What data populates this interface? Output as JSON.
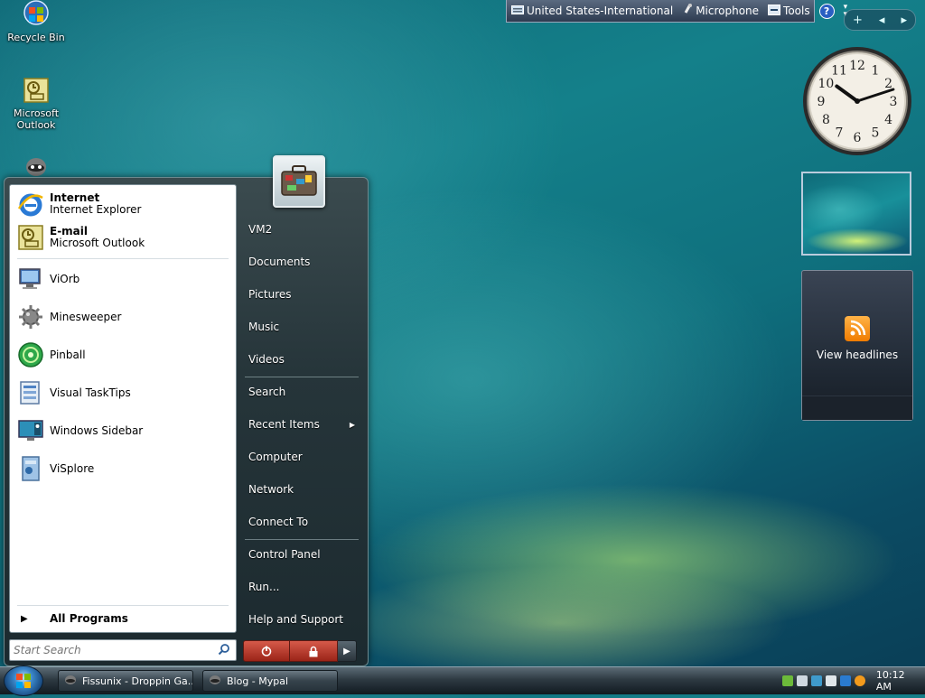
{
  "desktop": {
    "icons": [
      {
        "label": "Recycle Bin"
      },
      {
        "label": "Microsoft Outlook"
      }
    ]
  },
  "langbar": {
    "language": "United States-International",
    "microphone": "Microphone",
    "tools": "Tools",
    "help": "?"
  },
  "sidebar": {
    "controls": {
      "add": "+",
      "prev": "◂",
      "next": "▸"
    },
    "clock": {
      "hours": 10,
      "minutes": 12
    },
    "feed": {
      "label": "View headlines"
    }
  },
  "startmenu": {
    "pinned": [
      {
        "title": "Internet",
        "subtitle": "Internet Explorer"
      },
      {
        "title": "E-mail",
        "subtitle": "Microsoft Outlook"
      }
    ],
    "recent": [
      {
        "label": "ViOrb"
      },
      {
        "label": "Minesweeper"
      },
      {
        "label": "Pinball"
      },
      {
        "label": "Visual TaskTips"
      },
      {
        "label": "Windows Sidebar"
      },
      {
        "label": "ViSplore"
      }
    ],
    "all_programs": "All Programs",
    "search_placeholder": "Start Search",
    "right": [
      {
        "label": "VM2"
      },
      {
        "label": "Documents"
      },
      {
        "label": "Pictures"
      },
      {
        "label": "Music"
      },
      {
        "label": "Videos"
      },
      {
        "label": "Search"
      },
      {
        "label": "Recent Items"
      },
      {
        "label": "Computer"
      },
      {
        "label": "Network"
      },
      {
        "label": "Connect To"
      },
      {
        "label": "Control Panel"
      },
      {
        "label": "Run..."
      },
      {
        "label": "Help and Support"
      }
    ]
  },
  "taskbar": {
    "tasks": [
      {
        "label": "Fissunix - Droppin Ga..."
      },
      {
        "label": "Blog - Mypal"
      }
    ],
    "time": "10:12 AM"
  },
  "colors": {
    "power_red": "#b8372a",
    "rss_orange": "#f08a00",
    "accent_blue": "#2a6db5"
  }
}
